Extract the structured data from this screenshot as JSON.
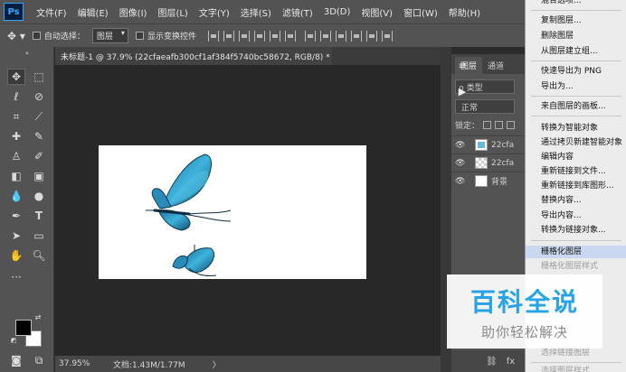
{
  "app": {
    "logo": "Ps"
  },
  "menu": [
    "文件(F)",
    "编辑(E)",
    "图像(I)",
    "图层(L)",
    "文字(Y)",
    "选择(S)",
    "滤镜(T)",
    "3D(D)",
    "视图(V)",
    "窗口(W)",
    "帮助(H)"
  ],
  "options": {
    "auto_select_label": "自动选择：",
    "auto_select_value": "图层",
    "show_transform_label": "显示变换控件"
  },
  "document": {
    "tab_title": "未标题-1 @ 37.9% (22cfaeafb300cf1af384f5740bc58672, RGB/8) *",
    "close": "×"
  },
  "status": {
    "zoom": "37.95%",
    "doc_info": "文档:1.43M/1.77M",
    "arrow": "〉"
  },
  "layers_panel": {
    "tabs": [
      "图层",
      "通道"
    ],
    "filter": "ρ 类型",
    "blend_mode": "正常",
    "lock_label": "锁定：",
    "layers": [
      {
        "name": "22cfa",
        "kind": "smart"
      },
      {
        "name": "22cfa",
        "kind": "transparent"
      },
      {
        "name": "背景",
        "kind": "background"
      }
    ],
    "bottom_fx": "fx"
  },
  "context_menu": {
    "items": [
      {
        "label": "混合选项...",
        "disabled": false,
        "highlight": false
      },
      {
        "label": "复制图层...",
        "disabled": false,
        "highlight": false
      },
      {
        "label": "删除图层",
        "disabled": false,
        "highlight": false
      },
      {
        "label": "从图层建立组...",
        "disabled": false,
        "highlight": false
      },
      {
        "label": "快速导出为 PNG",
        "disabled": false,
        "highlight": false
      },
      {
        "label": "导出为...",
        "disabled": false,
        "highlight": false
      },
      {
        "label": "来自图层的画板...",
        "disabled": false,
        "highlight": false
      },
      {
        "label": "转换为智能对象",
        "disabled": false,
        "highlight": false
      },
      {
        "label": "通过拷贝新建智能对象",
        "disabled": false,
        "highlight": false
      },
      {
        "label": "编辑内容",
        "disabled": false,
        "highlight": false
      },
      {
        "label": "重新链接到文件...",
        "disabled": false,
        "highlight": false
      },
      {
        "label": "重新链接到库图形...",
        "disabled": false,
        "highlight": false
      },
      {
        "label": "替换内容...",
        "disabled": false,
        "highlight": false
      },
      {
        "label": "导出内容...",
        "disabled": false,
        "highlight": false
      },
      {
        "label": "转换为链接对象...",
        "disabled": false,
        "highlight": false
      },
      {
        "label": "栅格化图层",
        "disabled": false,
        "highlight": true
      },
      {
        "label": "栅格化图层样式",
        "disabled": true,
        "highlight": false
      },
      {
        "label": "选择链接图层",
        "disabled": true,
        "highlight": false
      },
      {
        "label": "选择图层样式",
        "disabled": true,
        "highlight": false
      }
    ]
  },
  "watermark": {
    "title": "百科全说",
    "subtitle": "助你轻松解决"
  },
  "colors": {
    "accent": "#31a8ff",
    "canvas": "#ffffff",
    "highlight": "#c9d8f0",
    "butterfly": "#2f9bc6"
  }
}
